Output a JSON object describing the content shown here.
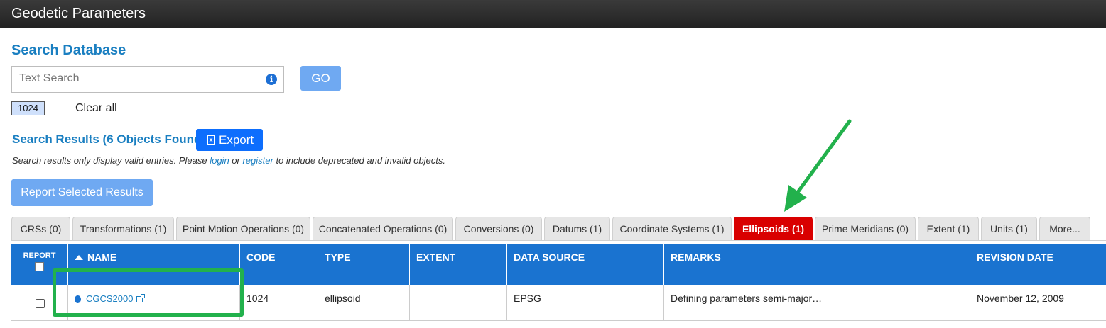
{
  "app": {
    "title": "Geodetic Parameters"
  },
  "search": {
    "heading": "Search Database",
    "placeholder": "Text Search",
    "go_label": "GO",
    "active_filter": "1024",
    "clear_label": "Clear all"
  },
  "results": {
    "heading": "Search Results (6 Objects Found)",
    "export_label": "Export",
    "note_before": "Search results only display valid entries. Please ",
    "note_login": "login",
    "note_or": " or ",
    "note_register": "register",
    "note_after": " to include deprecated and invalid objects.",
    "report_button": "Report Selected Results"
  },
  "tabs": [
    {
      "label": "CRSs (0)",
      "active": false
    },
    {
      "label": "Transformations (1)",
      "active": false
    },
    {
      "label": "Point Motion Operations (0)",
      "active": false
    },
    {
      "label": "Concatenated Operations (0)",
      "active": false
    },
    {
      "label": "Conversions (0)",
      "active": false
    },
    {
      "label": "Datums (1)",
      "active": false
    },
    {
      "label": "Coordinate Systems (1)",
      "active": false
    },
    {
      "label": "Ellipsoids (1)",
      "active": true
    },
    {
      "label": "Prime Meridians (0)",
      "active": false
    },
    {
      "label": "Extent (1)",
      "active": false
    },
    {
      "label": "Units (1)",
      "active": false
    },
    {
      "label": "More...",
      "active": false
    }
  ],
  "table": {
    "columns": {
      "report": "REPORT",
      "name": "NAME",
      "code": "CODE",
      "type": "TYPE",
      "extent": "EXTENT",
      "source": "DATA SOURCE",
      "remarks": "REMARKS",
      "revision": "REVISION DATE"
    },
    "rows": [
      {
        "name": "CGCS2000",
        "code": "1024",
        "type": "ellipsoid",
        "extent": "",
        "source": "EPSG",
        "remarks": "Defining parameters semi-major…",
        "revision": "November 12, 2009"
      }
    ]
  },
  "colors": {
    "accent": "#1a7fc1",
    "header_bar": "#1a73d0",
    "active_tab": "#d90000",
    "annotation": "#22b14c"
  }
}
